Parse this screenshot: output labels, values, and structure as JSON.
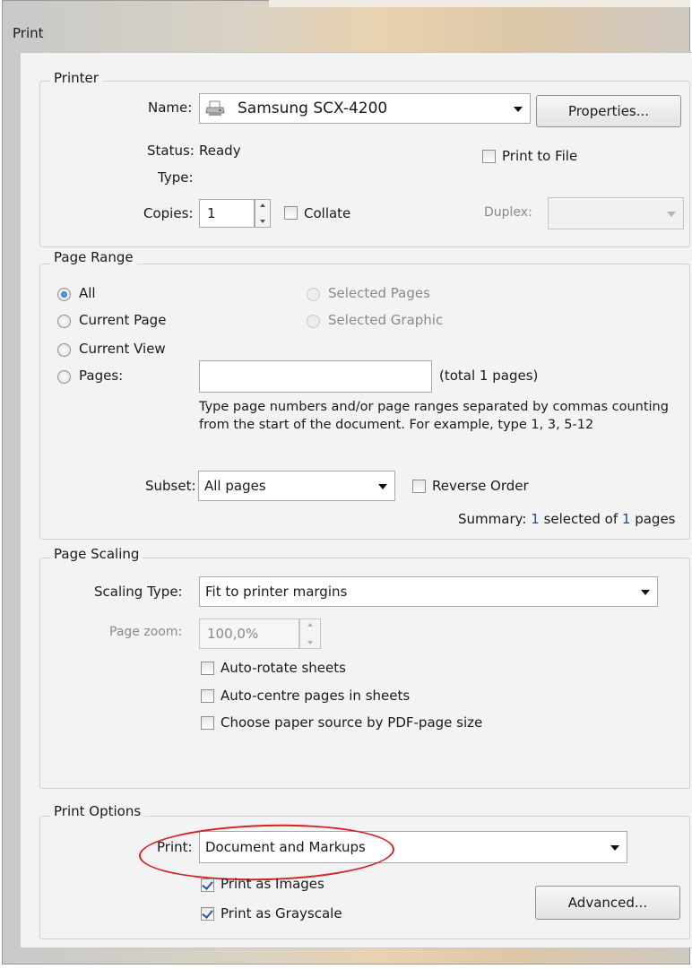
{
  "window": {
    "title": "Print"
  },
  "printer": {
    "legend": "Printer",
    "name_label": "Name:",
    "name_value": "Samsung SCX-4200",
    "properties_button": "Properties...",
    "status_label": "Status:",
    "status_value": "Ready",
    "type_label": "Type:",
    "type_value": "",
    "print_to_file_label": "Print to File",
    "copies_label": "Copies:",
    "copies_value": "1",
    "collate_label": "Collate",
    "duplex_label": "Duplex:",
    "duplex_value": ""
  },
  "page_range": {
    "legend": "Page Range",
    "options": [
      "All",
      "Current Page",
      "Current View",
      "Pages:"
    ],
    "selected_pages_label": "Selected Pages",
    "selected_graphic_label": "Selected Graphic",
    "pages_value": "",
    "total_text": "(total 1 pages)",
    "help_text": "Type page numbers and/or page ranges separated by commas counting from the start of the document. For example, type 1, 3, 5-12",
    "subset_label": "Subset:",
    "subset_value": "All pages",
    "reverse_order_label": "Reverse Order",
    "summary_prefix": "Summary:",
    "summary_selected": "1",
    "summary_mid": "selected of",
    "summary_total": "1",
    "summary_suffix": "pages"
  },
  "page_scaling": {
    "legend": "Page Scaling",
    "scaling_type_label": "Scaling Type:",
    "scaling_type_value": "Fit to printer margins",
    "page_zoom_label": "Page zoom:",
    "page_zoom_value": "100,0%",
    "auto_rotate_label": "Auto-rotate sheets",
    "auto_centre_label": "Auto-centre pages in sheets",
    "paper_source_label": "Choose paper source by PDF-page size"
  },
  "print_options": {
    "legend": "Print Options",
    "print_label": "Print:",
    "print_value": "Document and Markups",
    "print_as_images_label": "Print as Images",
    "print_as_grayscale_label": "Print as Grayscale",
    "advanced_button": "Advanced..."
  },
  "colors": {
    "accent": "#1f4e9b",
    "annotation": "#d42323"
  }
}
